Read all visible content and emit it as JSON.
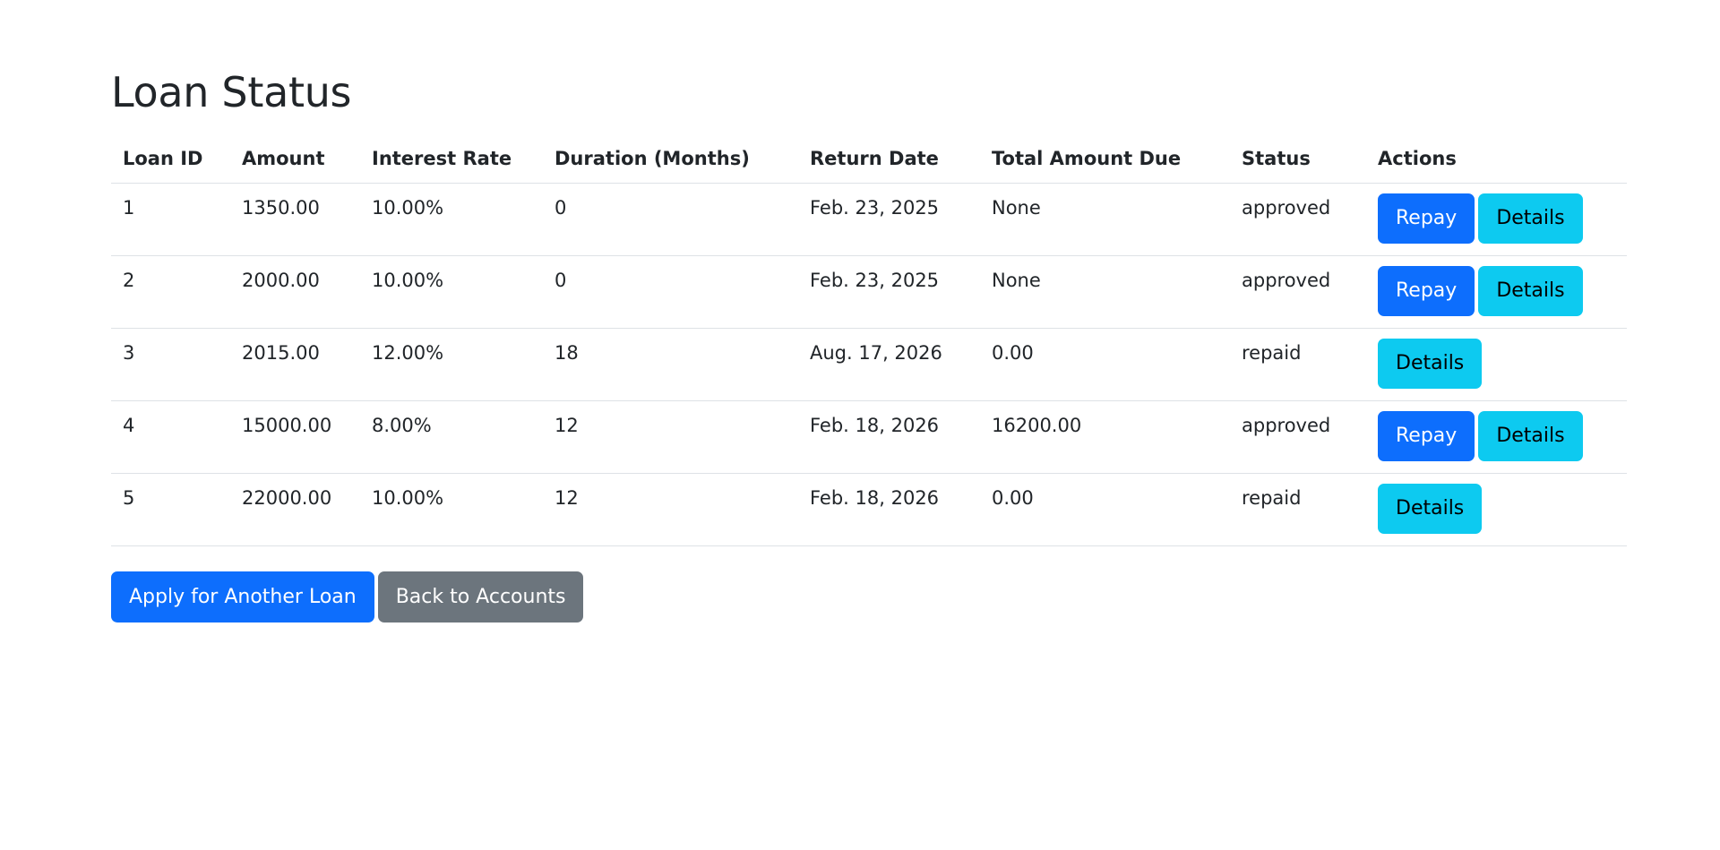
{
  "page": {
    "title": "Loan Status"
  },
  "table": {
    "headers": [
      "Loan ID",
      "Amount",
      "Interest Rate",
      "Duration (Months)",
      "Return Date",
      "Total Amount Due",
      "Status",
      "Actions"
    ],
    "rows": [
      {
        "id": "1",
        "amount": "1350.00",
        "rate": "10.00%",
        "duration": "0",
        "return_date": "Feb. 23, 2025",
        "total_due": "None",
        "status": "approved",
        "actions": [
          "Repay",
          "Details"
        ]
      },
      {
        "id": "2",
        "amount": "2000.00",
        "rate": "10.00%",
        "duration": "0",
        "return_date": "Feb. 23, 2025",
        "total_due": "None",
        "status": "approved",
        "actions": [
          "Repay",
          "Details"
        ]
      },
      {
        "id": "3",
        "amount": "2015.00",
        "rate": "12.00%",
        "duration": "18",
        "return_date": "Aug. 17, 2026",
        "total_due": "0.00",
        "status": "repaid",
        "actions": [
          "Details"
        ]
      },
      {
        "id": "4",
        "amount": "15000.00",
        "rate": "8.00%",
        "duration": "12",
        "return_date": "Feb. 18, 2026",
        "total_due": "16200.00",
        "status": "approved",
        "actions": [
          "Repay",
          "Details"
        ]
      },
      {
        "id": "5",
        "amount": "22000.00",
        "rate": "10.00%",
        "duration": "12",
        "return_date": "Feb. 18, 2026",
        "total_due": "0.00",
        "status": "repaid",
        "actions": [
          "Details"
        ]
      }
    ]
  },
  "footer": {
    "apply_label": "Apply for Another Loan",
    "back_label": "Back to Accounts"
  },
  "colors": {
    "primary": "#0d6efd",
    "info": "#0dcaf0",
    "secondary": "#6c757d",
    "text": "#212529",
    "border": "#dee2e6"
  }
}
